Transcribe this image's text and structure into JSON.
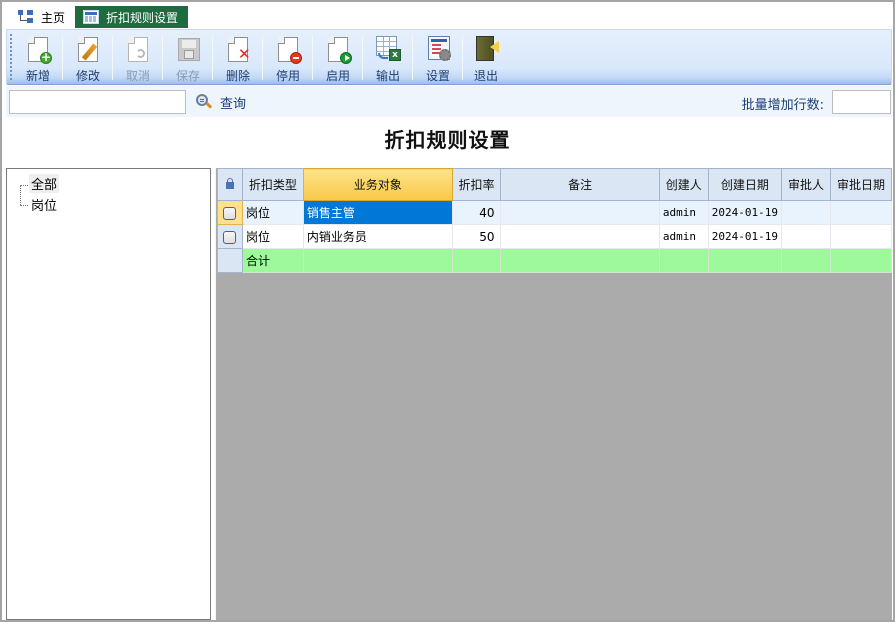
{
  "tabs": [
    {
      "label": "主页",
      "icon": "home-tree-icon",
      "active": false
    },
    {
      "label": "折扣规则设置",
      "icon": "grid-table-icon",
      "active": true
    }
  ],
  "toolbar": {
    "buttons": [
      {
        "id": "new",
        "label": "新增",
        "icon": "new-document-icon",
        "enabled": true
      },
      {
        "id": "edit",
        "label": "修改",
        "icon": "edit-document-icon",
        "enabled": true
      },
      {
        "id": "cancel",
        "label": "取消",
        "icon": "undo-document-icon",
        "enabled": false
      },
      {
        "id": "save",
        "label": "保存",
        "icon": "floppy-disk-icon",
        "enabled": false
      },
      {
        "id": "delete",
        "label": "删除",
        "icon": "delete-document-icon",
        "enabled": true
      },
      {
        "id": "disable",
        "label": "停用",
        "icon": "disable-document-icon",
        "enabled": true
      },
      {
        "id": "enable",
        "label": "启用",
        "icon": "enable-document-icon",
        "enabled": true
      },
      {
        "id": "export",
        "label": "输出",
        "icon": "export-excel-icon",
        "enabled": true
      },
      {
        "id": "settings",
        "label": "设置",
        "icon": "settings-icon",
        "enabled": true
      },
      {
        "id": "exit",
        "label": "退出",
        "icon": "exit-door-icon",
        "enabled": true
      }
    ]
  },
  "search": {
    "value": "",
    "placeholder": "",
    "query_label": "查询",
    "batch_rows_label": "批量增加行数:",
    "batch_rows_value": ""
  },
  "page_title": "折扣规则设置",
  "tree": {
    "items": [
      {
        "label": "全部",
        "selected": true
      },
      {
        "label": "岗位",
        "selected": false
      }
    ]
  },
  "grid": {
    "columns": [
      "折扣类型",
      "业务对象",
      "折扣率",
      "备注",
      "创建人",
      "创建日期",
      "审批人",
      "审批日期"
    ],
    "active_column": 1,
    "rows": [
      {
        "type": "岗位",
        "target": "销售主管",
        "rate": "40",
        "remark": "",
        "creator": "admin",
        "created": "2024-01-19",
        "approver": "",
        "approved": ""
      },
      {
        "type": "岗位",
        "target": "内销业务员",
        "rate": "50",
        "remark": "",
        "creator": "admin",
        "created": "2024-01-19",
        "approver": "",
        "approved": ""
      }
    ],
    "total_row": {
      "label": "合计"
    }
  },
  "colors": {
    "active_tab": "#1d6b3f",
    "selected_cell": "#0078d7",
    "total_row": "#9ef99a",
    "active_header": "#f9c847",
    "grid_empty": "#ababab"
  }
}
